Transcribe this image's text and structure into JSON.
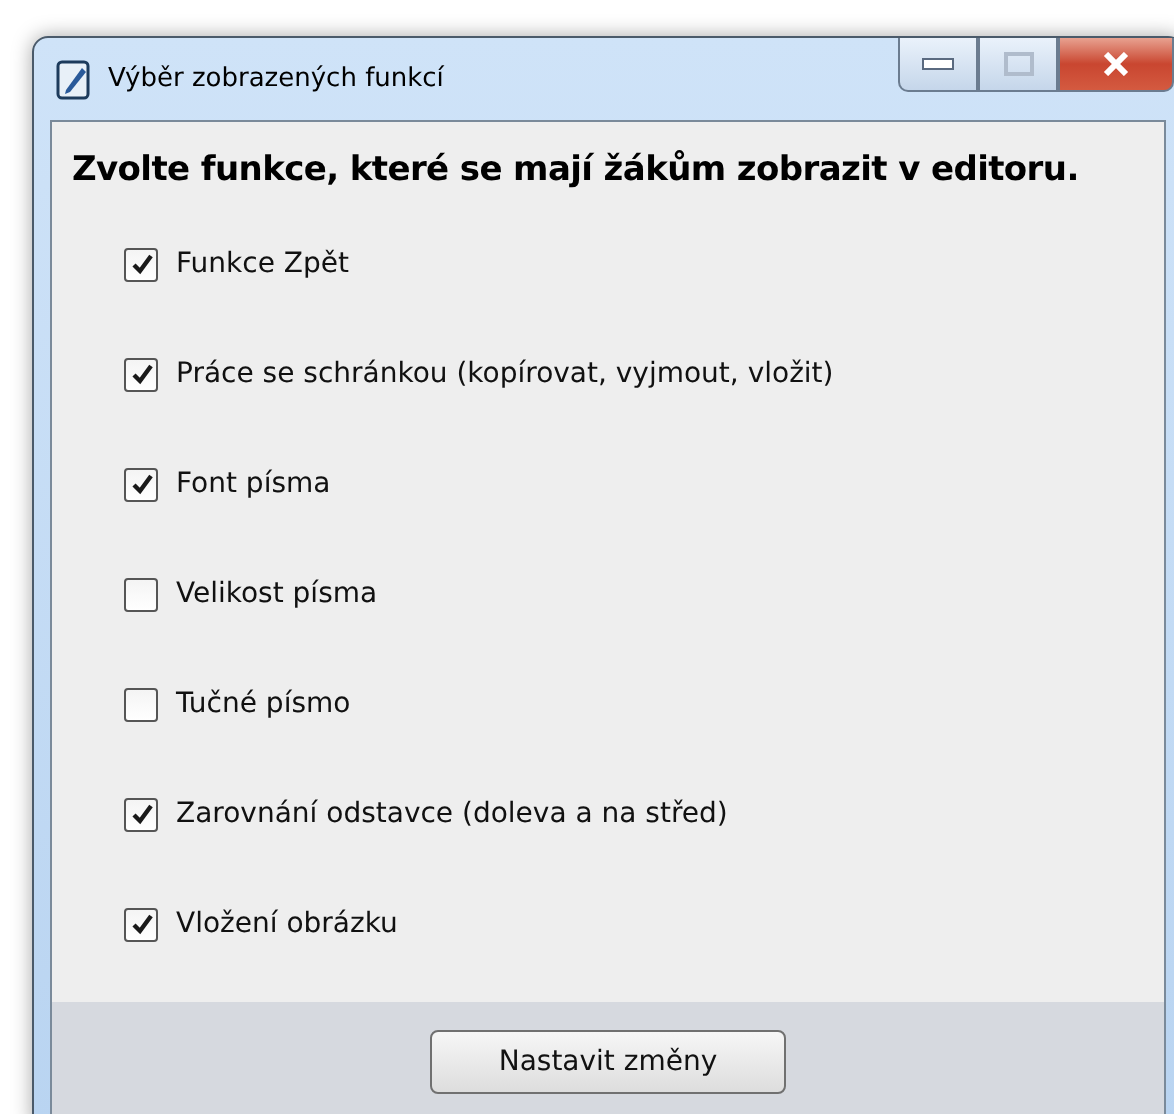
{
  "window": {
    "title": "Výběr zobrazených funkcí"
  },
  "heading": "Zvolte funkce, které se mají žákům zobrazit v editoru.",
  "options": [
    {
      "label": "Funkce Zpět",
      "checked": true
    },
    {
      "label": "Práce se schránkou (kopírovat, vyjmout, vložit)",
      "checked": true
    },
    {
      "label": "Font písma",
      "checked": true
    },
    {
      "label": "Velikost písma",
      "checked": false
    },
    {
      "label": "Tučné písmo",
      "checked": false
    },
    {
      "label": "Zarovnání odstavce (doleva a na střed)",
      "checked": true
    },
    {
      "label": "Vložení obrázku",
      "checked": true
    }
  ],
  "button": "Nastavit změny"
}
